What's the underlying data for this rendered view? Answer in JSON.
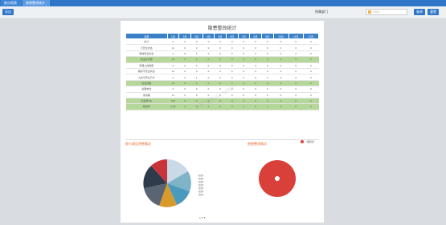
{
  "tabs": [
    "统计报表",
    "隐患整改统计"
  ],
  "toolbar": {
    "export_label": "导出",
    "dept_label": "所属部门",
    "date_placeholder": "2020",
    "query_label": "查询",
    "reset_label": "重置"
  },
  "title": "隐患整改统计",
  "table": {
    "headers": [
      "名称",
      "1月",
      "2月",
      "3月",
      "4月",
      "5月",
      "6月",
      "7月",
      "8月",
      "9月",
      "10月",
      "11月",
      "12月"
    ],
    "rows": [
      {
        "name": "合计",
        "green": false,
        "vals": [
          "0",
          "0",
          "0",
          "0",
          "0",
          "0",
          "0",
          "0",
          "0",
          "0",
          "0",
          "0"
        ]
      },
      {
        "name": "不安全状态",
        "green": false,
        "vals": [
          "11",
          "0",
          "0",
          "0",
          "0",
          "0",
          "0",
          "0",
          "0",
          "0",
          "0",
          "0"
        ]
      },
      {
        "name": "场地安全隐患",
        "green": false,
        "vals": [
          "0",
          "0",
          "1",
          "0",
          "0",
          "0",
          "0",
          "0",
          "0",
          "0",
          "0",
          "0"
        ]
      },
      {
        "name": "隐患总问题",
        "green": true,
        "vals": [
          "11",
          "0",
          "1",
          "0",
          "0",
          "0",
          "0",
          "0",
          "0",
          "0",
          "0",
          "0"
        ]
      },
      {
        "name": "管理上的缺陷",
        "green": false,
        "vals": [
          "0",
          "0",
          "0",
          "0",
          "0",
          "0",
          "0",
          "0",
          "0",
          "0",
          "0",
          "0"
        ]
      },
      {
        "name": "物的不安全状态",
        "green": false,
        "vals": [
          "11",
          "0",
          "0",
          "0",
          "0",
          "0",
          "0",
          "0",
          "0",
          "0",
          "0",
          "0"
        ]
      },
      {
        "name": "人的不安全行为",
        "green": false,
        "vals": [
          "0",
          "0",
          "1",
          "0",
          "0",
          "0",
          "0",
          "0",
          "0",
          "0",
          "0",
          "0"
        ]
      },
      {
        "name": "隐患问题",
        "green": true,
        "vals": [
          "11",
          "0",
          "1",
          "0",
          "0",
          "0",
          "0",
          "0",
          "0",
          "0",
          "0",
          "0"
        ]
      },
      {
        "name": "逾期未改",
        "green": false,
        "vals": [
          "0",
          "0",
          "0",
          "0",
          "0",
          "0",
          "0",
          "0",
          "0",
          "0",
          "0",
          "0"
        ]
      },
      {
        "name": "未到期",
        "green": false,
        "vals": [
          "11",
          "0",
          "0",
          "0",
          "0",
          "0",
          "0",
          "0",
          "0",
          "0",
          "0",
          "0"
        ]
      },
      {
        "name": "隐患率(%)",
        "green": true,
        "vals": [
          "100",
          "0",
          "0",
          "0",
          "0",
          "0",
          "0",
          "0",
          "0",
          "0",
          "0",
          "0"
        ]
      },
      {
        "name": "整改率",
        "green": true,
        "vals": [
          "0.00",
          "0",
          "0",
          "0",
          "0",
          "0",
          "0",
          "0",
          "0",
          "0",
          "0",
          "0"
        ]
      }
    ]
  },
  "section_left": "各行政区隐患情况",
  "section_right": "隐患整改情况",
  "legend_right": "一般隐患",
  "pie_legend": [
    "隐患1",
    "隐患2",
    "隐患3",
    "隐患4",
    "隐患5",
    "隐患6",
    "隐患7"
  ],
  "pager": "1/7",
  "watermark": "yangguo.sian",
  "colors": {
    "primary": "#2f76c8",
    "green_row": "#b5d79a",
    "accent": "#e8692c",
    "ring": "#d9403a"
  }
}
